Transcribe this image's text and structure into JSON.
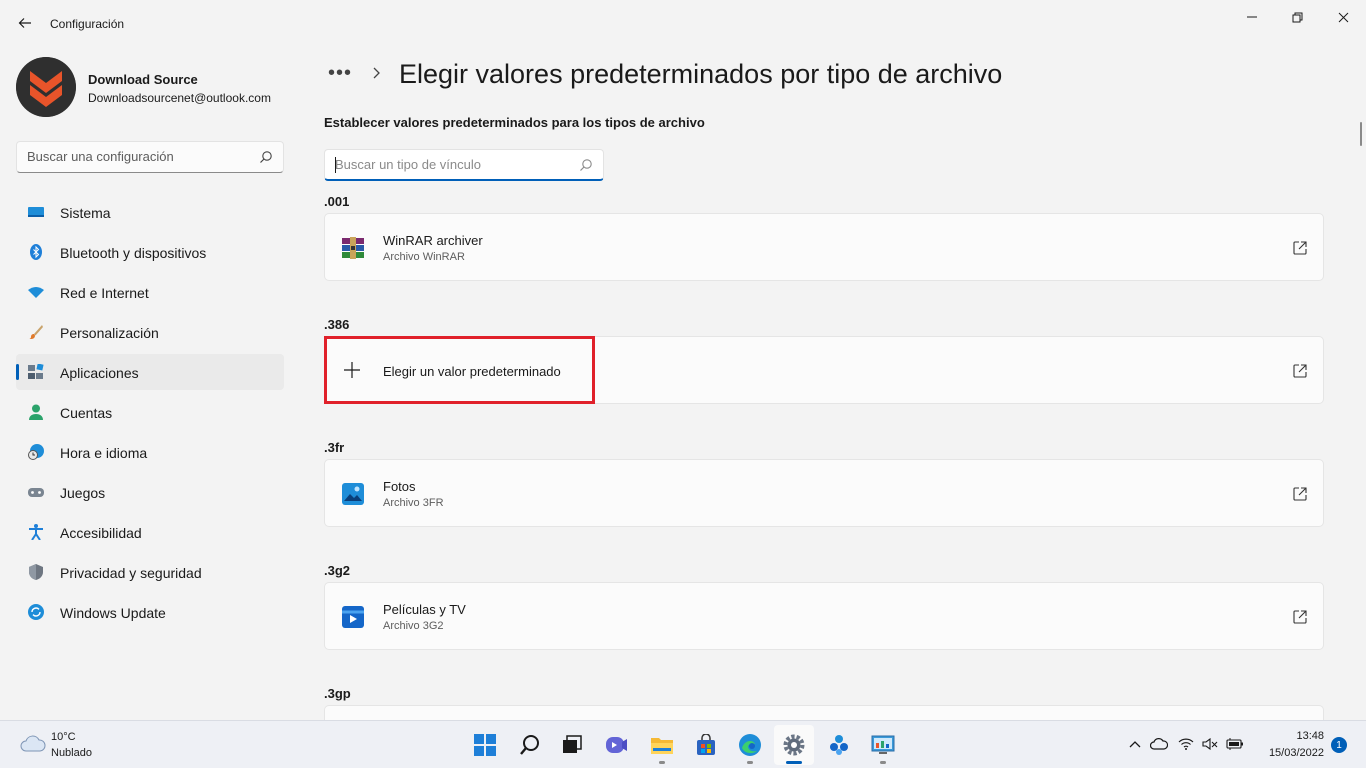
{
  "window": {
    "title": "Configuración"
  },
  "profile": {
    "name": "Download Source",
    "email": "Downloadsourcenet@outlook.com"
  },
  "sidebar": {
    "search_placeholder": "Buscar una configuración",
    "items": [
      {
        "label": "Sistema",
        "icon": "monitor-icon"
      },
      {
        "label": "Bluetooth y dispositivos",
        "icon": "bluetooth-icon"
      },
      {
        "label": "Red e Internet",
        "icon": "wifi-icon"
      },
      {
        "label": "Personalización",
        "icon": "brush-icon"
      },
      {
        "label": "Aplicaciones",
        "icon": "apps-icon",
        "active": true
      },
      {
        "label": "Cuentas",
        "icon": "person-icon"
      },
      {
        "label": "Hora e idioma",
        "icon": "clock-globe-icon"
      },
      {
        "label": "Juegos",
        "icon": "gamepad-icon"
      },
      {
        "label": "Accesibilidad",
        "icon": "accessibility-icon"
      },
      {
        "label": "Privacidad y seguridad",
        "icon": "shield-icon"
      },
      {
        "label": "Windows Update",
        "icon": "update-icon"
      }
    ]
  },
  "main": {
    "breadcrumb_more": "•••",
    "title": "Elegir valores predeterminados por tipo de archivo",
    "subtitle": "Establecer valores predeterminados para los tipos de archivo",
    "search_placeholder": "Buscar un tipo de vínculo",
    "file_types": [
      {
        "ext": ".001",
        "app": "WinRAR archiver",
        "desc": "Archivo WinRAR",
        "icon": "winrar-icon"
      },
      {
        "ext": ".386",
        "choose": "Elegir un valor predeterminado",
        "icon": "plus-icon",
        "highlighted": true
      },
      {
        "ext": ".3fr",
        "app": "Fotos",
        "desc": "Archivo 3FR",
        "icon": "photos-icon"
      },
      {
        "ext": ".3g2",
        "app": "Películas y TV",
        "desc": "Archivo 3G2",
        "icon": "movies-tv-icon"
      },
      {
        "ext": ".3gp"
      }
    ]
  },
  "taskbar": {
    "weather_temp": "10°C",
    "weather_cond": "Nublado",
    "apps": [
      "start-icon",
      "search-icon",
      "task-view-icon",
      "teams-chat-icon",
      "file-explorer-icon",
      "store-icon",
      "edge-icon",
      "settings-icon",
      "sharepoint-icon",
      "control-panel-icon"
    ],
    "active_app": "settings-icon",
    "time": "13:48",
    "date": "15/03/2022",
    "notifications": "1"
  },
  "colors": {
    "accent": "#005fb8",
    "highlight": "#e0202a",
    "background": "#f3f3f3",
    "card": "#fbfbfb"
  }
}
